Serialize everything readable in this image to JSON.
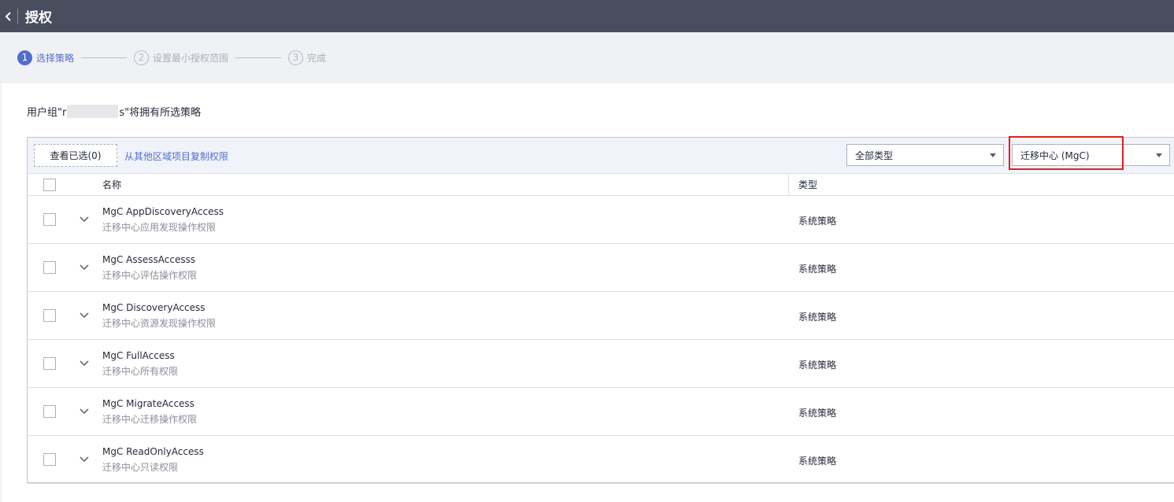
{
  "header": {
    "title": "授权"
  },
  "steps": [
    {
      "num": "1",
      "label": "选择策略",
      "active": true
    },
    {
      "num": "2",
      "label": "设置最小授权范围",
      "active": false
    },
    {
      "num": "3",
      "label": "完成",
      "active": false
    }
  ],
  "description": {
    "prefix": "用户组\"r",
    "suffix": "s\"将拥有所选策略"
  },
  "toolbar": {
    "view_selected": "查看已选(0)",
    "copy_link": "从其他区域项目复制权限",
    "type_select": "全部类型",
    "service_select": "迁移中心 (MgC)"
  },
  "table": {
    "headers": {
      "name": "名称",
      "type": "类型"
    },
    "rows": [
      {
        "name": "MgC AppDiscoveryAccess",
        "desc": "迁移中心应用发现操作权限",
        "type": "系统策略"
      },
      {
        "name": "MgC AssessAccesss",
        "desc": "迁移中心评估操作权限",
        "type": "系统策略"
      },
      {
        "name": "MgC DiscoveryAccess",
        "desc": "迁移中心资源发现操作权限",
        "type": "系统策略"
      },
      {
        "name": "MgC FullAccess",
        "desc": "迁移中心所有权限",
        "type": "系统策略"
      },
      {
        "name": "MgC MigrateAccess",
        "desc": "迁移中心迁移操作权限",
        "type": "系统策略"
      },
      {
        "name": "MgC ReadOnlyAccess",
        "desc": "迁移中心只读权限",
        "type": "系统策略"
      }
    ]
  },
  "icons": {
    "back": "chevron-left-icon",
    "expand": "chevron-down-icon",
    "dropdown": "caret-down-icon"
  },
  "colors": {
    "header_bg": "#494e5e",
    "accent": "#526ecc",
    "highlight": "#e0201b"
  }
}
